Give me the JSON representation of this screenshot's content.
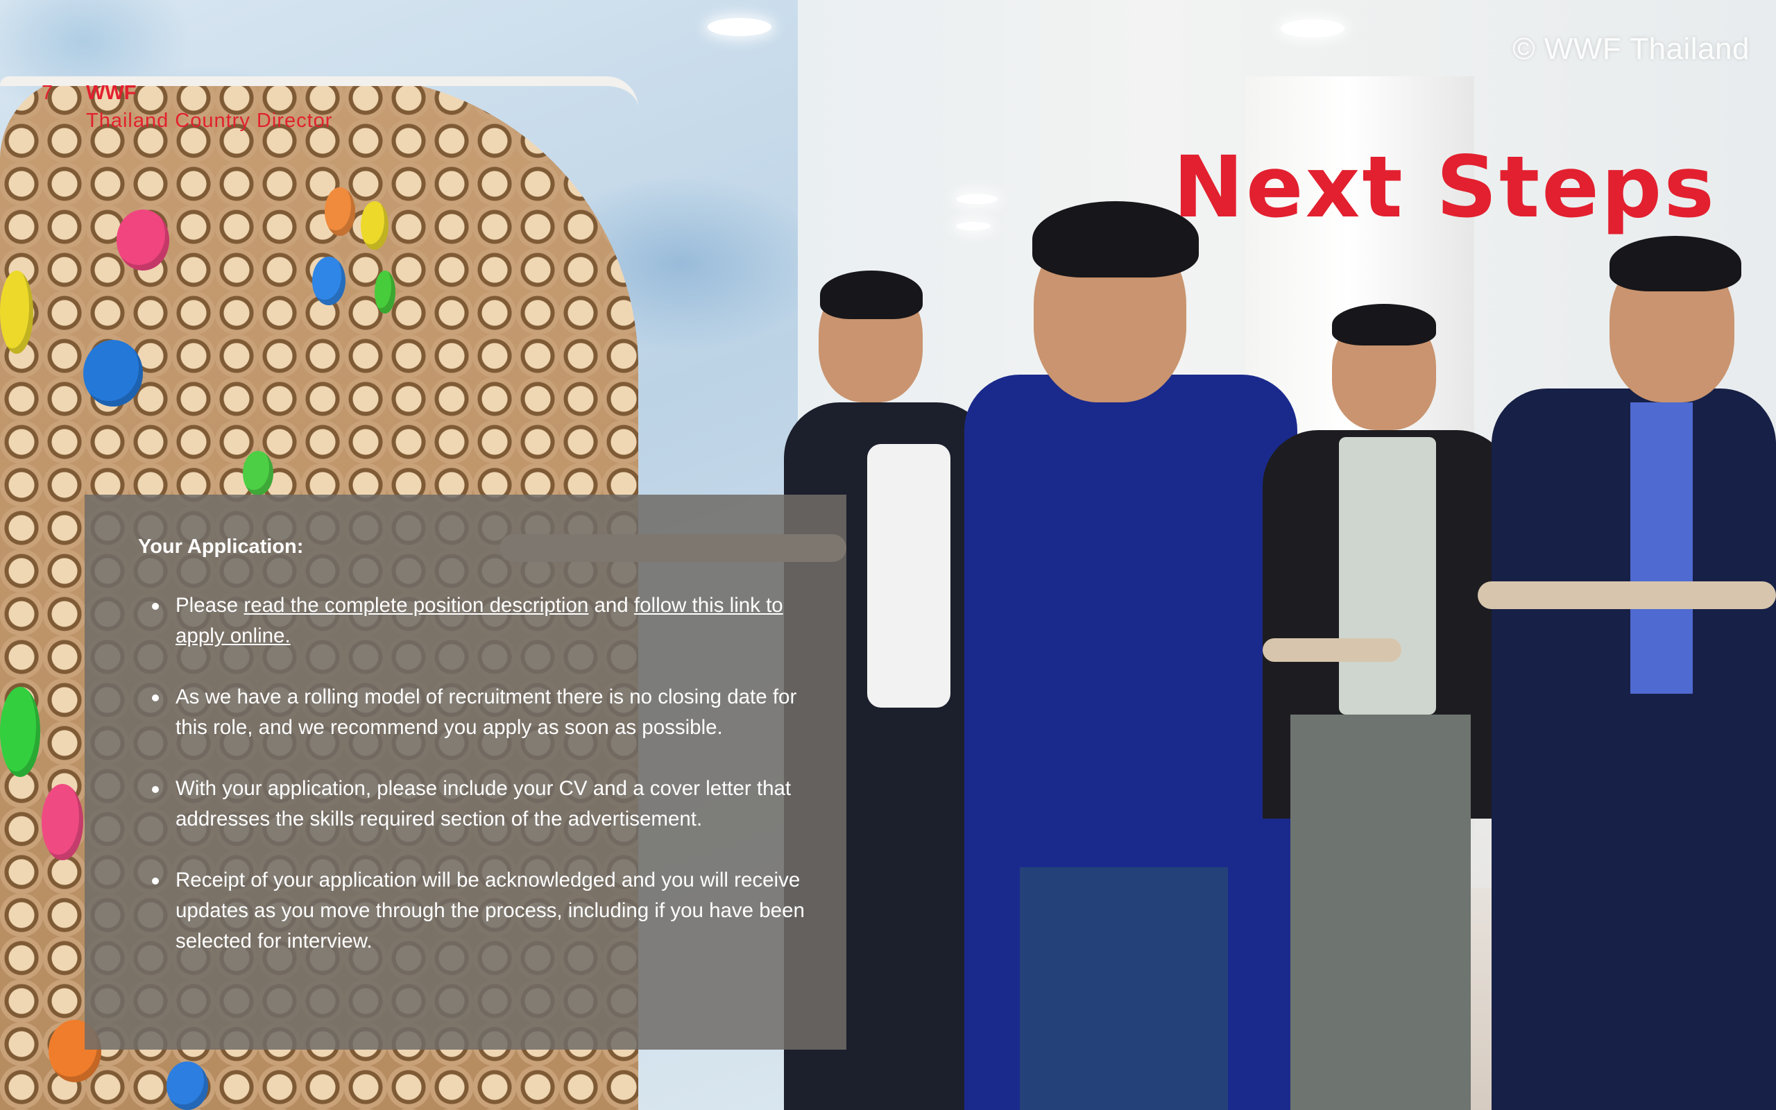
{
  "watermark": "© WWF Thailand",
  "header": {
    "page_number": "7",
    "organization": "WWF",
    "subtitle": "Thailand Country Director"
  },
  "title": "Next Steps",
  "application": {
    "heading": "Your Application:",
    "step1": {
      "before": " Please ",
      "link1": "read the complete position description",
      "middle": " and ",
      "link2": "follow this link to apply online."
    },
    "step2": " As we have a rolling model of recruitment there is no closing date for this role, and we recommend you apply as soon as possible.",
    "step3": "With your application, please include your CV and a cover letter that addresses the skills required section of the advertisement.",
    "step4": "Receipt of your application will be acknowledged and you will receive updates as you move through the process, including if you have been selected for interview."
  },
  "colors": {
    "accent": "#e2202f",
    "panel": "#706c68",
    "panel_text": "#ffffff"
  },
  "icons": {
    "bullet": "bullet-dot-icon"
  }
}
